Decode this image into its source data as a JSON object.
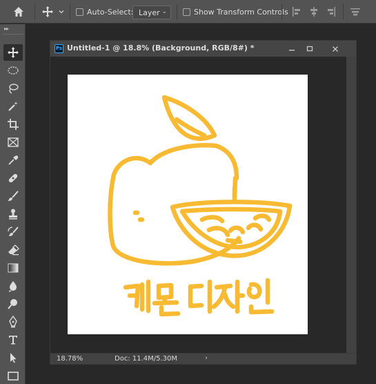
{
  "options_bar": {
    "auto_select_label": "Auto-Select:",
    "auto_select_checked": false,
    "layer_select_value": "Layer",
    "show_transform_label": "Show Transform Controls",
    "show_transform_checked": false,
    "icons": [
      "home-icon",
      "move-tool-icon",
      "chevron-down-icon",
      "align-left-icon",
      "align-center-icon",
      "align-right-icon",
      "align-top-icon"
    ]
  },
  "toolbar": {
    "tools": [
      {
        "name": "move-tool",
        "icon": "move-icon",
        "active": true
      },
      {
        "name": "marquee-tool",
        "icon": "ellipse-marquee-icon"
      },
      {
        "name": "lasso-tool",
        "icon": "lasso-icon"
      },
      {
        "name": "magic-wand-tool",
        "icon": "magic-wand-icon"
      },
      {
        "name": "crop-tool",
        "icon": "crop-icon"
      },
      {
        "name": "frame-tool",
        "icon": "frame-icon"
      },
      {
        "name": "eyedropper-tool",
        "icon": "eyedropper-icon"
      },
      {
        "name": "healing-brush-tool",
        "icon": "bandage-icon"
      },
      {
        "name": "brush-tool",
        "icon": "brush-icon"
      },
      {
        "name": "clone-stamp-tool",
        "icon": "stamp-icon"
      },
      {
        "name": "history-brush-tool",
        "icon": "history-brush-icon"
      },
      {
        "name": "eraser-tool",
        "icon": "eraser-icon"
      },
      {
        "name": "gradient-tool",
        "icon": "gradient-icon"
      },
      {
        "name": "blur-tool",
        "icon": "blur-icon"
      },
      {
        "name": "dodge-tool",
        "icon": "dodge-icon"
      },
      {
        "name": "pen-tool",
        "icon": "pen-icon"
      },
      {
        "name": "type-tool",
        "icon": "type-icon"
      },
      {
        "name": "path-selection-tool",
        "icon": "arrow-icon"
      },
      {
        "name": "rectangle-tool",
        "icon": "rectangle-icon"
      }
    ]
  },
  "document": {
    "title": "Untitled-1 @ 18.8% (Background, RGB/8#) *",
    "zoom": "18.78%",
    "doc_size": "Doc: 11.4M/5.30M",
    "artwork_text": "레몬디자인",
    "artwork_color": "#f8ba32",
    "canvas_background": "#ffffff"
  },
  "colors": {
    "workspace": "#282828",
    "panel": "#535353",
    "accent_ps": "#31a8ff"
  }
}
